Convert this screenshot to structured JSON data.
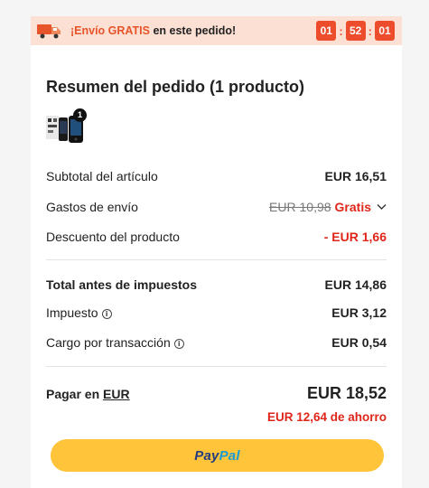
{
  "banner": {
    "text_accent": "¡Envío GRATIS",
    "text_rest": " en este pedido!",
    "timer": {
      "hours": "01",
      "minutes": "52",
      "seconds": "01"
    }
  },
  "summary": {
    "title": "Resumen del pedido (1 producto)",
    "product_quantity": "1",
    "rows": {
      "subtotal": {
        "label": "Subtotal del artículo",
        "value": "EUR 16,51"
      },
      "shipping": {
        "label": "Gastos de envío",
        "original": "EUR 10,98",
        "value": "Gratis"
      },
      "discount": {
        "label": "Descuento del producto",
        "value": "- EUR 1,66"
      },
      "pretax": {
        "label": "Total antes de impuestos",
        "value": "EUR 14,86"
      },
      "tax": {
        "label": "Impuesto",
        "value": "EUR 3,12"
      },
      "fee": {
        "label": "Cargo por transacción",
        "value": "EUR 0,54"
      }
    },
    "pay": {
      "label": "Pagar en ",
      "currency": "EUR",
      "total": "EUR 18,52",
      "saving": "EUR 12,64 de ahorro"
    },
    "paypal": {
      "part1": "Pay",
      "part2": "Pal"
    }
  },
  "colors": {
    "banner_bg": "#fde0d4",
    "accent_orange": "#ee4d2d",
    "discount_red": "#e0261a",
    "paypal_button": "#ffc43a"
  }
}
